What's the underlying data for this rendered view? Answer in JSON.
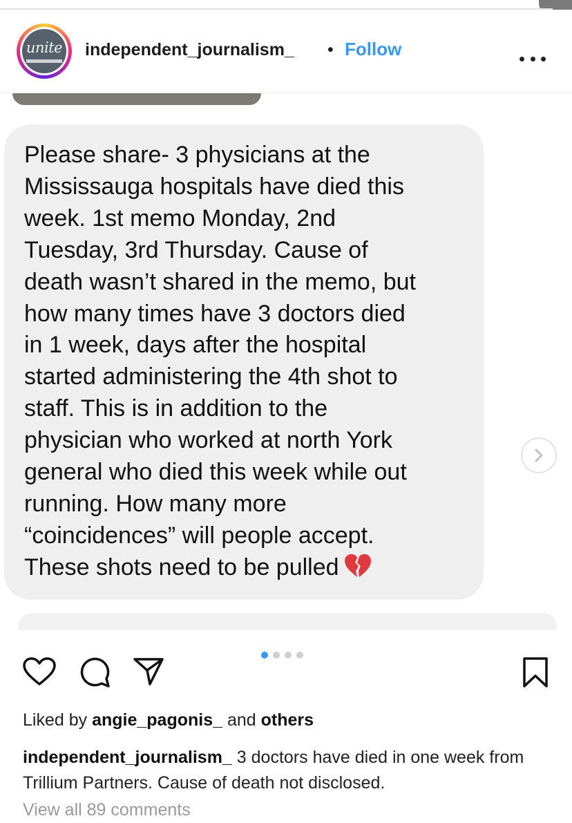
{
  "header": {
    "avatar_text": "unite",
    "username": "independent_journalism_",
    "separator": "•",
    "follow_label": "Follow"
  },
  "post": {
    "message_lines": [
      "Please share- 3 physicians at the",
      "Mississauga hospitals have died this",
      "week. 1st memo Monday, 2nd",
      "Tuesday, 3rd Thursday. Cause of",
      "death wasn’t shared in the memo, but",
      "how many times have 3 doctors died",
      "in 1 week, days after the hospital",
      "started administering the 4th shot to",
      "staff. This is in addition to the",
      "physician who worked at north York",
      "general who died this week while out",
      "running. How many more",
      "“coincidences” will people accept.",
      "These shots need to be pulled"
    ],
    "emoji_icon": "broken-heart-icon",
    "carousel": {
      "total": 4,
      "active_index": 0
    }
  },
  "engagement": {
    "liked_prefix": "Liked by",
    "liked_user": "angie_pagonis_",
    "liked_joiner": "and",
    "liked_others": "others"
  },
  "caption": {
    "username": "independent_journalism_",
    "text": "3 doctors have died in one week from Trillium Partners. Cause of death not disclosed."
  },
  "comments": {
    "view_all_label": "View all 89 comments"
  },
  "colors": {
    "accent": "#3897f0",
    "bubble": "#efefef",
    "muted": "#9a9a9a"
  }
}
